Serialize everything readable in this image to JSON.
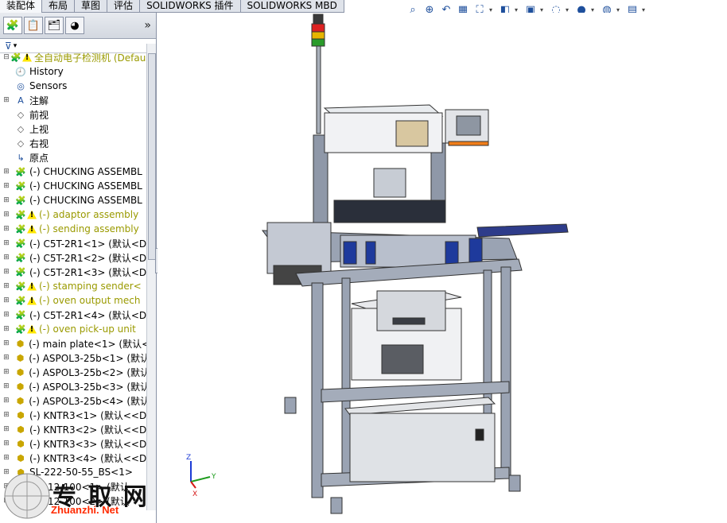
{
  "tabs": [
    {
      "label": "装配体",
      "active": true
    },
    {
      "label": "布局",
      "active": false
    },
    {
      "label": "草图",
      "active": false
    },
    {
      "label": "评估",
      "active": false
    },
    {
      "label": "SOLIDWORKS 插件",
      "active": false
    },
    {
      "label": "SOLIDWORKS MBD",
      "active": false
    }
  ],
  "toolbar": [
    "zoom-to-fit-icon",
    "zoom-area-icon",
    "previous-view-icon",
    "section-view-icon",
    "dynamic-annotation-icon",
    "view-orientation-icon",
    "display-style-icon",
    "hide-show-icon",
    "edit-appearance-icon",
    "apply-scene-icon",
    "view-settings-icon"
  ],
  "panel": {
    "expand_label": "»",
    "filter_label": "▾"
  },
  "tree": [
    {
      "label": "全自动电子检测机  (Defau",
      "icon": "assembly",
      "warn": true,
      "expand": "−",
      "indent": 0,
      "yellow": true
    },
    {
      "label": "History",
      "icon": "history",
      "warn": false,
      "expand": "",
      "indent": 1
    },
    {
      "label": "Sensors",
      "icon": "sensor",
      "warn": false,
      "expand": "",
      "indent": 1
    },
    {
      "label": "注解",
      "icon": "annotation",
      "warn": false,
      "expand": "+",
      "indent": 1
    },
    {
      "label": "前视",
      "icon": "plane",
      "warn": false,
      "expand": "",
      "indent": 1
    },
    {
      "label": "上视",
      "icon": "plane",
      "warn": false,
      "expand": "",
      "indent": 1
    },
    {
      "label": "右视",
      "icon": "plane",
      "warn": false,
      "expand": "",
      "indent": 1
    },
    {
      "label": "原点",
      "icon": "origin",
      "warn": false,
      "expand": "",
      "indent": 1
    },
    {
      "label": "(-) CHUCKING ASSEMBL",
      "icon": "subassembly",
      "warn": false,
      "expand": "+",
      "indent": 1
    },
    {
      "label": "(-) CHUCKING ASSEMBL",
      "icon": "subassembly",
      "warn": false,
      "expand": "+",
      "indent": 1
    },
    {
      "label": "(-) CHUCKING ASSEMBL",
      "icon": "subassembly",
      "warn": false,
      "expand": "+",
      "indent": 1
    },
    {
      "label": "(-) adaptor assembly",
      "icon": "subassembly",
      "warn": true,
      "expand": "+",
      "indent": 1,
      "yellow": true
    },
    {
      "label": "(-) sending assembly",
      "icon": "subassembly",
      "warn": true,
      "expand": "+",
      "indent": 1,
      "yellow": true
    },
    {
      "label": "(-) C5T-2R1<1>  (默认<D",
      "icon": "subassembly",
      "warn": false,
      "expand": "+",
      "indent": 1
    },
    {
      "label": "(-) C5T-2R1<2>  (默认<D",
      "icon": "subassembly",
      "warn": false,
      "expand": "+",
      "indent": 1
    },
    {
      "label": "(-) C5T-2R1<3>  (默认<D",
      "icon": "subassembly",
      "warn": false,
      "expand": "+",
      "indent": 1
    },
    {
      "label": "(-) stamping sender<",
      "icon": "subassembly",
      "warn": true,
      "expand": "+",
      "indent": 1,
      "yellow": true
    },
    {
      "label": "(-) oven output mech",
      "icon": "subassembly",
      "warn": true,
      "expand": "+",
      "indent": 1,
      "yellow": true
    },
    {
      "label": "(-) C5T-2R1<4>  (默认<D",
      "icon": "subassembly",
      "warn": false,
      "expand": "+",
      "indent": 1
    },
    {
      "label": "(-) oven pick-up unit",
      "icon": "subassembly",
      "warn": true,
      "expand": "+",
      "indent": 1,
      "yellow": true
    },
    {
      "label": "(-) main plate<1>  (默认<",
      "icon": "part",
      "warn": false,
      "expand": "+",
      "indent": 1
    },
    {
      "label": "(-) ASPOL3-25b<1>  (默认",
      "icon": "part",
      "warn": false,
      "expand": "+",
      "indent": 1
    },
    {
      "label": "(-) ASPOL3-25b<2>  (默认",
      "icon": "part",
      "warn": false,
      "expand": "+",
      "indent": 1
    },
    {
      "label": "(-) ASPOL3-25b<3>  (默认",
      "icon": "part",
      "warn": false,
      "expand": "+",
      "indent": 1
    },
    {
      "label": "(-) ASPOL3-25b<4>  (默认",
      "icon": "part",
      "warn": false,
      "expand": "+",
      "indent": 1
    },
    {
      "label": "(-) KNTR3<1>  (默认<<D",
      "icon": "part",
      "warn": false,
      "expand": "+",
      "indent": 1
    },
    {
      "label": "(-) KNTR3<2>  (默认<<D",
      "icon": "part",
      "warn": false,
      "expand": "+",
      "indent": 1
    },
    {
      "label": "(-) KNTR3<3>  (默认<<D",
      "icon": "part",
      "warn": false,
      "expand": "+",
      "indent": 1
    },
    {
      "label": "(-) KNTR3<4>  (默认<<D",
      "icon": "part",
      "warn": false,
      "expand": "+",
      "indent": 1
    },
    {
      "label": "SL-222-50-55_BS<1>",
      "icon": "part",
      "warn": false,
      "expand": "+",
      "indent": 1
    },
    {
      "label": "NFA12-100<1>  (默认",
      "icon": "part",
      "warn": false,
      "expand": "+",
      "indent": 1
    },
    {
      "label": "NFA12-100<2>  (默认",
      "icon": "part",
      "warn": false,
      "expand": "+",
      "indent": 1
    }
  ],
  "triad": {
    "x": "X",
    "y": "Y",
    "z": "Z"
  },
  "watermark": {
    "text": "专 取 网",
    "url": "Zhuanzhi. Net"
  }
}
